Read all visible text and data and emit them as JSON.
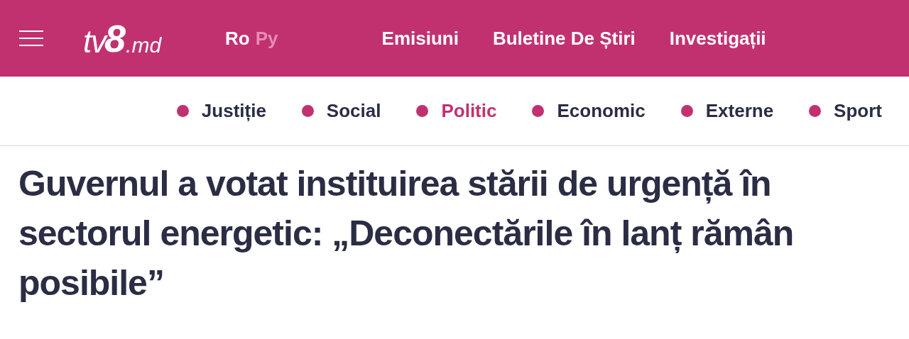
{
  "header": {
    "logo": {
      "main": "tv",
      "digit": "8",
      "suffix": ".md"
    },
    "languages": [
      {
        "label": "Ro",
        "selected": true
      },
      {
        "label": "Py",
        "selected": false
      }
    ],
    "nav": [
      "Emisiuni",
      "Buletine De Știri",
      "Investigații"
    ]
  },
  "categories": [
    {
      "label": "Justiție",
      "selected": false
    },
    {
      "label": "Social",
      "selected": false
    },
    {
      "label": "Politic",
      "selected": true
    },
    {
      "label": "Economic",
      "selected": false
    },
    {
      "label": "Externe",
      "selected": false
    },
    {
      "label": "Sport",
      "selected": false
    }
  ],
  "headline": "Guvernul a votat instituirea stării de urgență în sectorul energetic: „Deconectările în lanț rămân posibile”"
}
